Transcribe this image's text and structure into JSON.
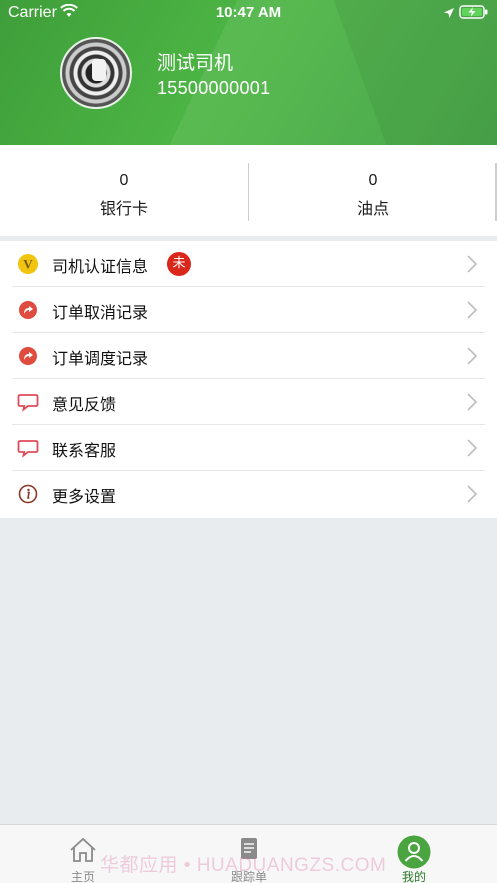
{
  "status_bar": {
    "carrier": "Carrier",
    "time": "10:47 AM"
  },
  "profile": {
    "name": "测试司机",
    "phone": "15500000001"
  },
  "stats": [
    {
      "value": "0",
      "label": "银行卡"
    },
    {
      "value": "0",
      "label": "油点"
    }
  ],
  "menu": [
    {
      "label": "司机认证信息",
      "icon": "v-badge-icon",
      "badge": "未",
      "icon_color": "#f1c40f"
    },
    {
      "label": "订单取消记录",
      "icon": "redirect-icon",
      "icon_color": "#e04b3f"
    },
    {
      "label": "订单调度记录",
      "icon": "redirect-icon",
      "icon_color": "#e04b3f"
    },
    {
      "label": "意见反馈",
      "icon": "chat-bubble-icon",
      "icon_color": "#e04b5a"
    },
    {
      "label": "联系客服",
      "icon": "chat-bubble-icon",
      "icon_color": "#e04b5a"
    },
    {
      "label": "更多设置",
      "icon": "info-icon",
      "icon_color": "#8b3a2a"
    }
  ],
  "tabs": [
    {
      "label": "主页",
      "icon": "home-icon"
    },
    {
      "label": "跟踪单",
      "icon": "document-icon"
    },
    {
      "label": "我的",
      "icon": "user-icon",
      "active": true
    }
  ],
  "watermark": "华都应用 • HUADUANGZS.COM",
  "colors": {
    "header_green": "#4cb544",
    "badge_red": "#d9271c",
    "active_tab_green": "#4aa540"
  }
}
